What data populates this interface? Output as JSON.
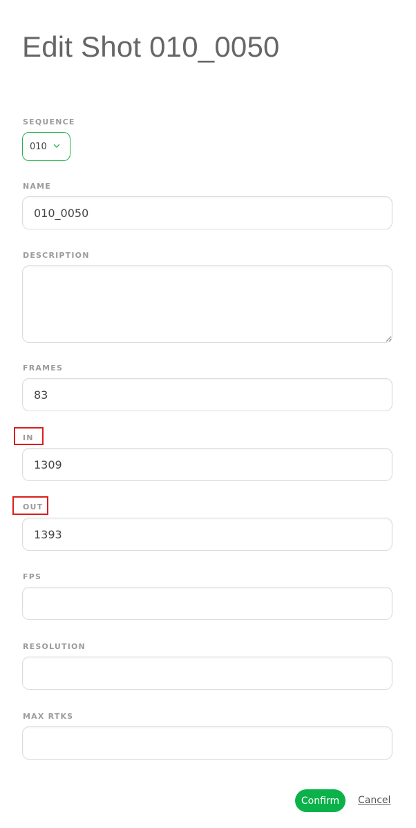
{
  "page": {
    "title": "Edit Shot 010_0050"
  },
  "form": {
    "sequence": {
      "label": "SEQUENCE",
      "value": "010"
    },
    "name": {
      "label": "NAME",
      "value": "010_0050"
    },
    "description": {
      "label": "DESCRIPTION",
      "value": ""
    },
    "frames": {
      "label": "FRAMES",
      "value": "83"
    },
    "in": {
      "label": "IN",
      "value": "1309"
    },
    "out": {
      "label": "OUT",
      "value": "1393"
    },
    "fps": {
      "label": "FPS",
      "value": ""
    },
    "resolution": {
      "label": "RESOLUTION",
      "value": ""
    },
    "max_rtks": {
      "label": "MAX RTKS",
      "value": ""
    }
  },
  "actions": {
    "confirm_label": "Confirm",
    "cancel_label": "Cancel"
  },
  "colors": {
    "accent": "#0bb24a",
    "highlight": "#d81e1e"
  }
}
